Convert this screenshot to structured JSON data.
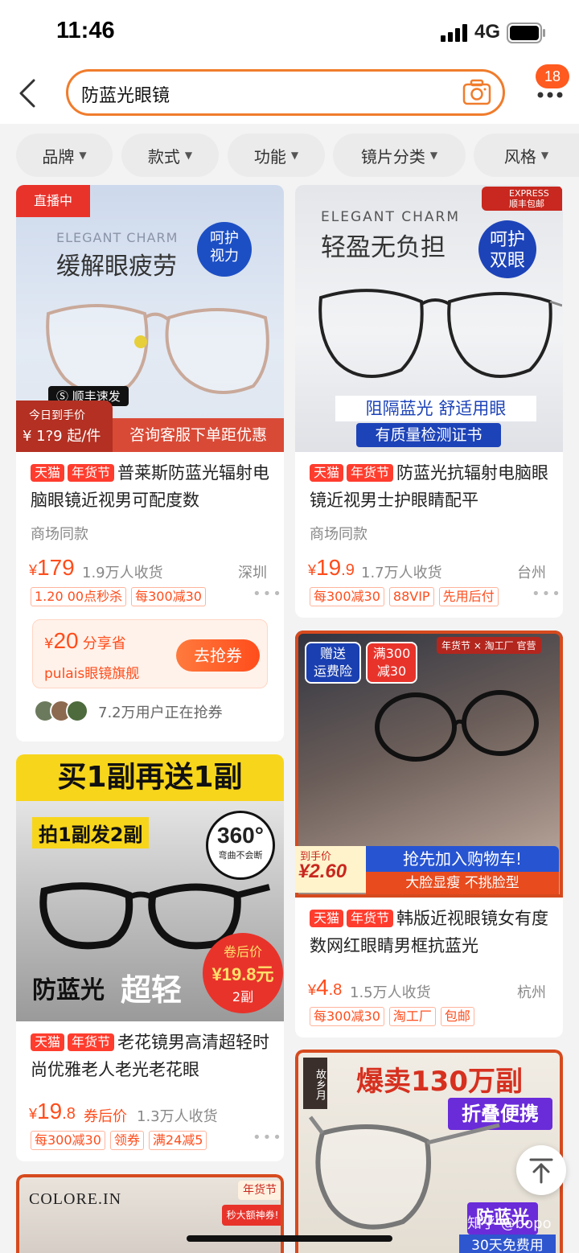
{
  "status": {
    "time": "11:46",
    "network": "4G"
  },
  "header": {
    "query": "防蓝光眼镜",
    "badge": "18"
  },
  "filters": [
    "品牌",
    "款式",
    "功能",
    "镜片分类",
    "风格"
  ],
  "p1": {
    "live": "直播中",
    "img_en": "ELEGANT CHARM",
    "img_title": "缓解眼疲劳",
    "img_bubble1": "呵护",
    "img_bubble2": "视力",
    "sf": "顺丰速发",
    "today": "今日到手价",
    "today_price": "¥ 1?9 起/件",
    "banner": "咨询客服下单距优惠",
    "tag1": "天猫",
    "tag2": "年货节",
    "title": "普莱斯防蓝光辐射电脑眼镜近视男可配度数",
    "sub": "商场同款",
    "price_int": "179",
    "sold": "1.9万人收货",
    "city": "深圳",
    "promos": [
      "1.20 00点秒杀",
      "每300减30"
    ],
    "coupon_amount": "20",
    "coupon_unit": "分享省",
    "coupon_store": "pulais眼镜旗舰",
    "coupon_btn": "去抢券",
    "grab_text": "7.2万用户正在抢券"
  },
  "p2": {
    "img_en": "ELEGANT CHARM",
    "img_title": "轻盈无负担",
    "img_bubble1": "呵护",
    "img_bubble2": "双眼",
    "express1": "EXPRESS",
    "express2": "顺丰包邮",
    "img_line1": "阻隔蓝光 舒适用眼",
    "img_line2": "有质量检测证书",
    "tag1": "天猫",
    "tag2": "年货节",
    "title": "防蓝光抗辐射电脑眼镜近视男士护眼睛配平",
    "sub": "商场同款",
    "price_int": "19",
    "price_dec": ".9",
    "sold": "1.7万人收货",
    "city": "台州",
    "promos": [
      "每300减30",
      "88VIP",
      "先用后付"
    ]
  },
  "p3": {
    "img_gift1": "赠送",
    "img_gift2": "运费险",
    "img_deal1": "满300",
    "img_deal2": "减30",
    "img_brand": "年货节 × 淘工厂 官营",
    "img_price_label": "到手价",
    "img_price": "¥2.60",
    "img_cta": "抢先加入购物车!",
    "img_cta2": "大脸显瘦 不挑脸型",
    "tag1": "天猫",
    "tag2": "年货节",
    "title": "韩版近视眼镜女有度数网红眼睛男框抗蓝光",
    "price_int": "4",
    "price_dec": ".8",
    "sold": "1.5万人收货",
    "city": "杭州",
    "promos": [
      "每300减30",
      "淘工厂",
      "包邮"
    ]
  },
  "p4": {
    "img_top": "买1副再送1副",
    "img_sub": "拍1副发2副",
    "img_360": "360°",
    "img_360b": "弯曲不会断",
    "img_feat": "防蓝光",
    "img_feat2": "超轻",
    "img_price_label": "卷后价",
    "img_price": "¥19.8元",
    "img_price_sub": "2副",
    "tag1": "天猫",
    "tag2": "年货节",
    "title": "老花镜男高清超轻时尚优雅老人老光老花眼",
    "price_int": "19",
    "price_dec": ".8",
    "price_note": "券后价",
    "sold": "1.3万人收货",
    "promos": [
      "每300减30",
      "领券",
      "满24减5"
    ]
  },
  "p5": {
    "img_brand": "故乡月",
    "img_title": "爆卖130万副",
    "img_sub": "折叠便携",
    "img_badge": "防蓝光",
    "img_badge2": "30天免费用",
    "watermark": "知乎 @bopo"
  },
  "p6": {
    "img_brand": "COLORE.IN",
    "img_tag": "年货节",
    "img_coupon": "秒大额神券!"
  },
  "colors": {
    "accent": "#ff4d1c",
    "search_border": "#f07c2c",
    "tmall": "#ff3d2e"
  }
}
